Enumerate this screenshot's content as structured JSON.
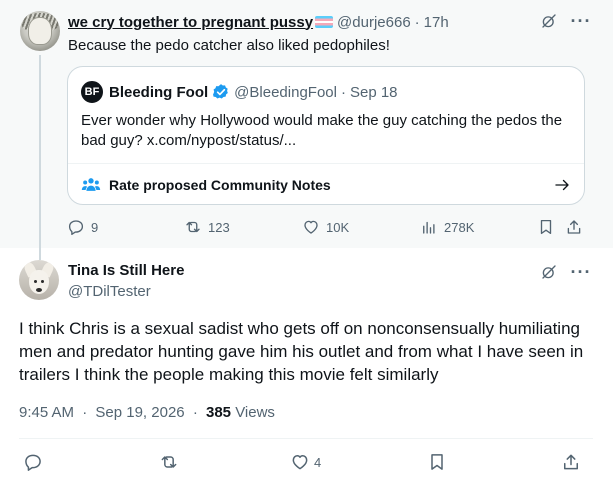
{
  "parent_tweet": {
    "display_name": "we cry together to pregnant pussy",
    "handle": "@durje666",
    "time": "17h",
    "text": "Because the pedo catcher also liked pedophiles!",
    "quote": {
      "avatar_letters": "BF",
      "display_name": "Bleeding Fool",
      "handle": "@BleedingFool",
      "date": "Sep 18",
      "text": "Ever wonder why Hollywood would make the guy catching the pedos the bad guy? x.com/nypost/status/...",
      "community_notes_label": "Rate proposed Community Notes"
    },
    "stats": {
      "replies": "9",
      "reposts": "123",
      "likes": "10K",
      "views": "278K"
    }
  },
  "reply_tweet": {
    "display_name": "Tina Is Still Here",
    "handle": "@TDilTester",
    "text": "I think Chris is a sexual sadist who gets off on nonconsensually humiliating men and predator hunting gave him his outlet and from what I have seen in trailers I think the people making this movie felt similarly",
    "time": "9:45 AM",
    "date": "Sep 19, 2026",
    "views_count": "385",
    "views_label": "Views",
    "stats": {
      "likes": "4"
    }
  },
  "colors": {
    "text": "#0f1419",
    "muted": "#536471",
    "verified": "#1d9bf0",
    "highlight_bg": "#f7f9f9"
  }
}
